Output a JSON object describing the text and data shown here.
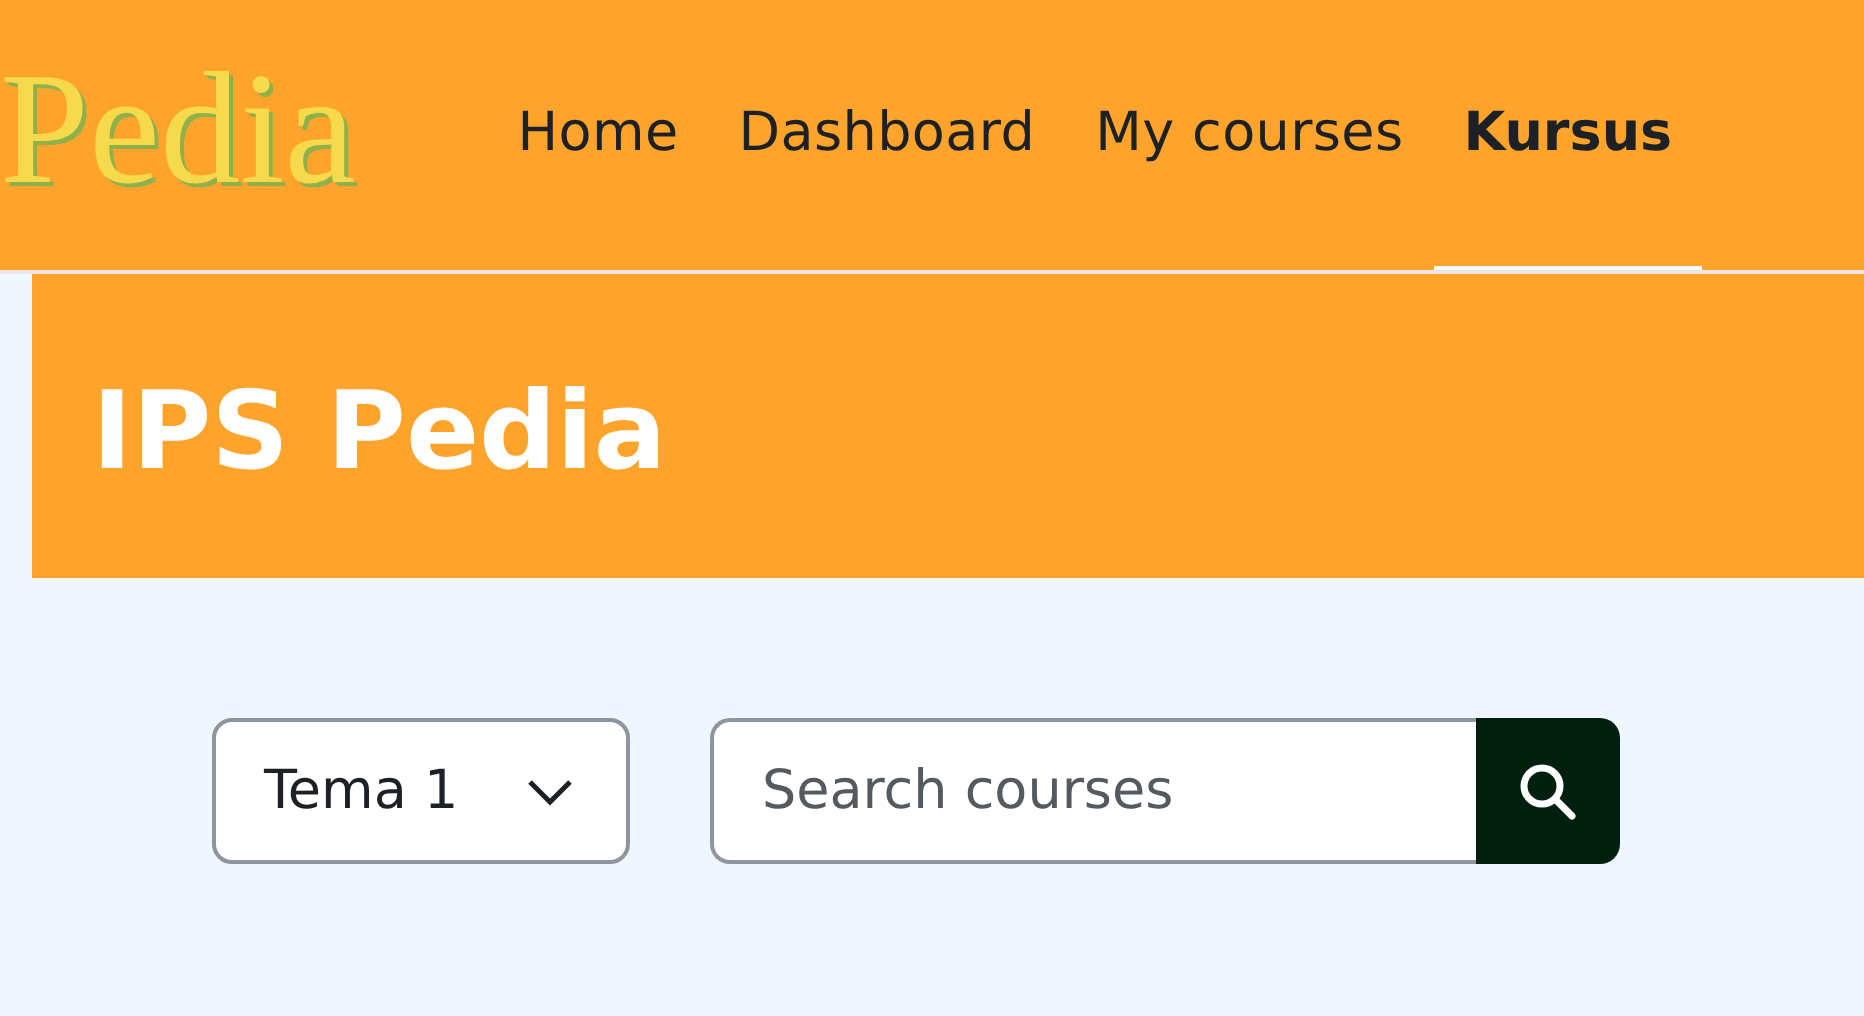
{
  "logo": {
    "text": "Pedia"
  },
  "nav": [
    {
      "label": "Home",
      "selected": false
    },
    {
      "label": "Dashboard",
      "selected": false
    },
    {
      "label": "My courses",
      "selected": false
    },
    {
      "label": "Kursus",
      "selected": true
    }
  ],
  "banner": {
    "title": "IPS Pedia"
  },
  "filter": {
    "value": "Tema 1"
  },
  "search": {
    "placeholder": "Search courses"
  }
}
